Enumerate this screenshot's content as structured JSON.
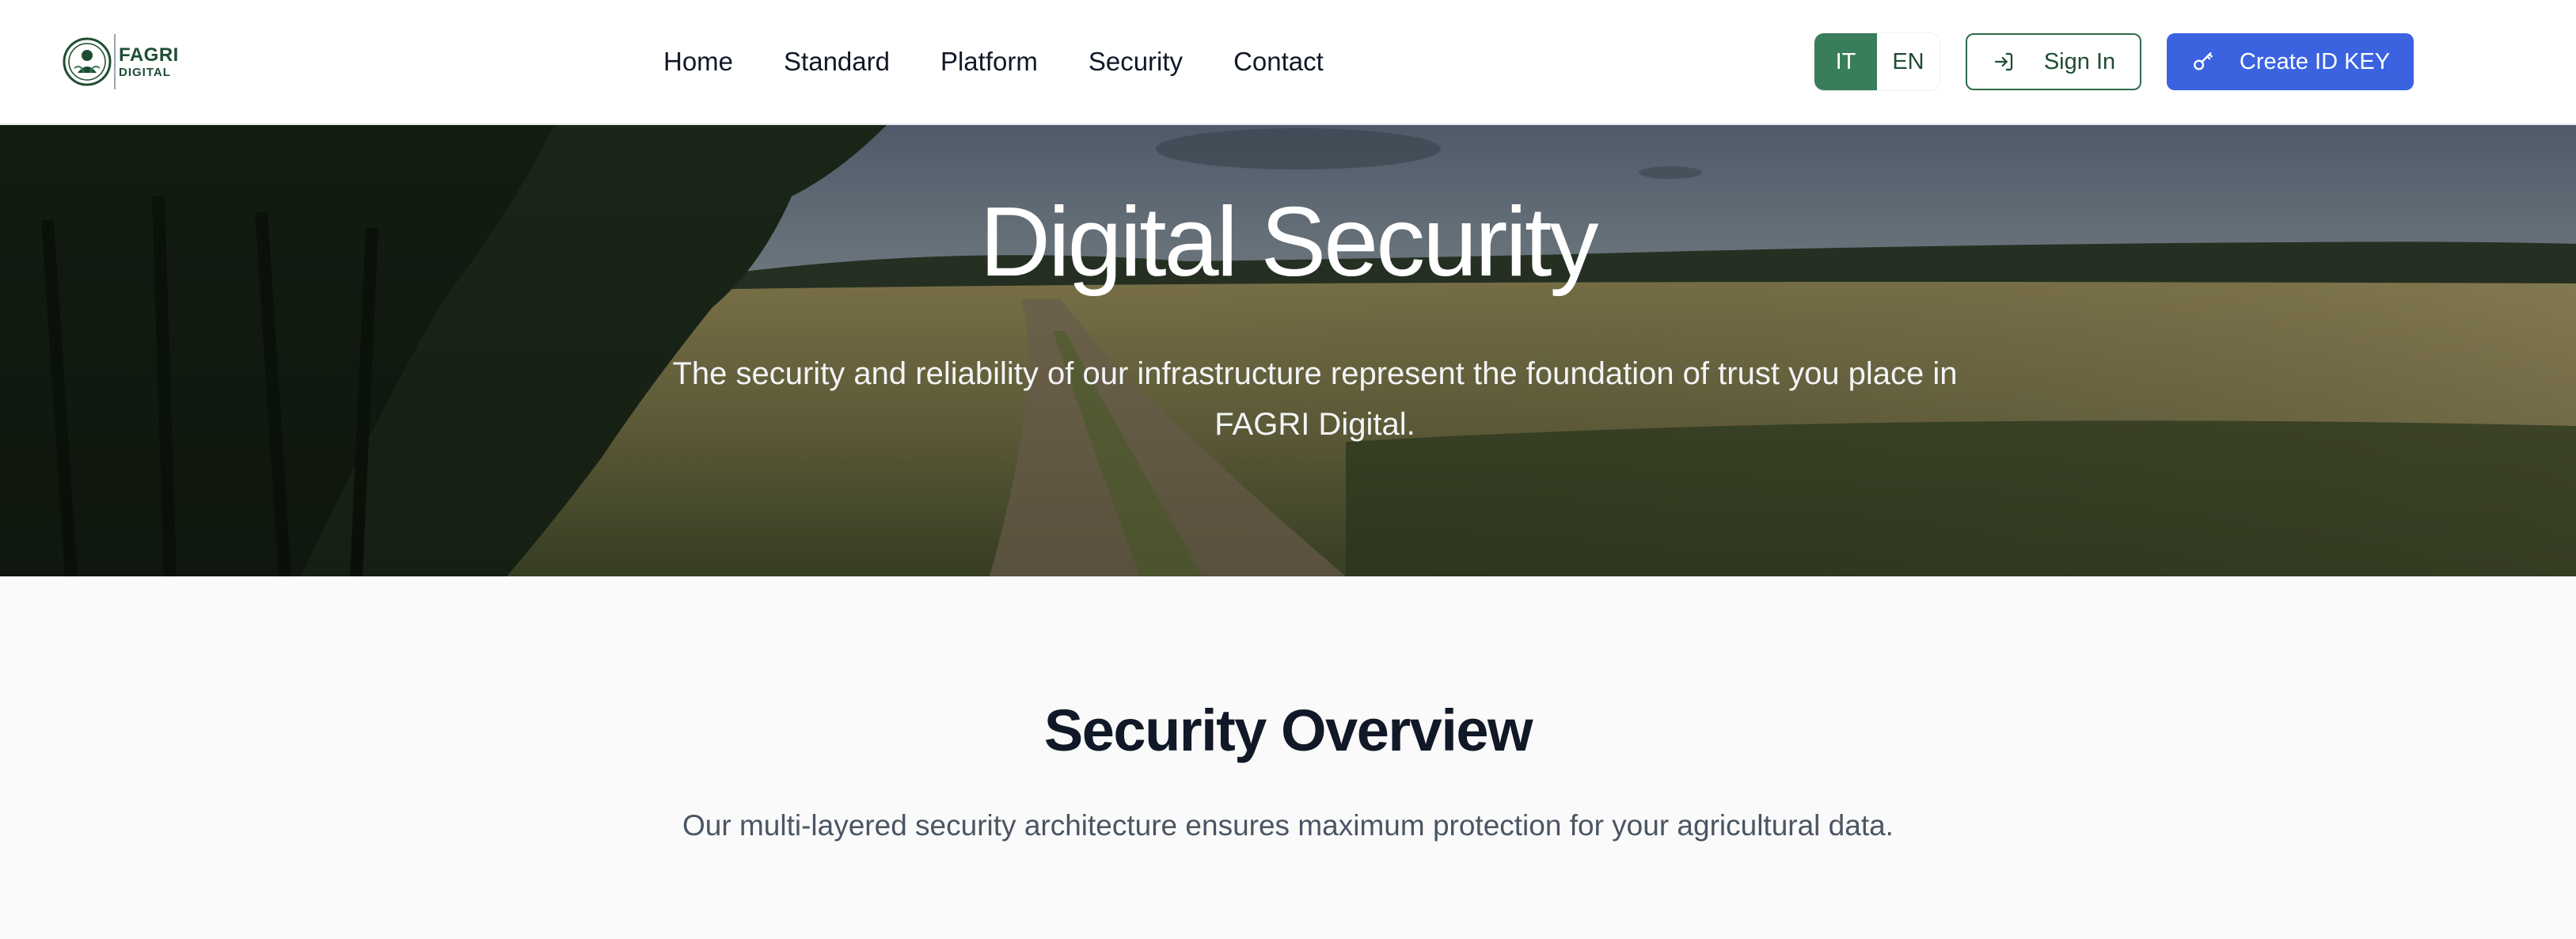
{
  "brand": {
    "name_line1": "FAGRI",
    "name_line2": "DIGITAL",
    "primary_color": "#3a7d5a",
    "accent_blue": "#3b63e0"
  },
  "nav": {
    "items": [
      {
        "label": "Home"
      },
      {
        "label": "Standard"
      },
      {
        "label": "Platform"
      },
      {
        "label": "Security"
      },
      {
        "label": "Contact"
      }
    ]
  },
  "language": {
    "options": [
      "IT",
      "EN"
    ],
    "selected": "IT"
  },
  "actions": {
    "signin_label": "Sign In",
    "signin_icon": "login-icon",
    "create_label": "Create ID KEY",
    "create_icon": "key-icon"
  },
  "hero": {
    "title": "Digital Security",
    "subtitle": "The security and reliability of our infrastructure represent the foundation of trust you place in FAGRI Digital.",
    "background": "wheat-field-with-dirt-path-and-trees"
  },
  "overview": {
    "title": "Security Overview",
    "subtitle": "Our multi-layered security architecture ensures maximum protection for your agricultural data."
  }
}
